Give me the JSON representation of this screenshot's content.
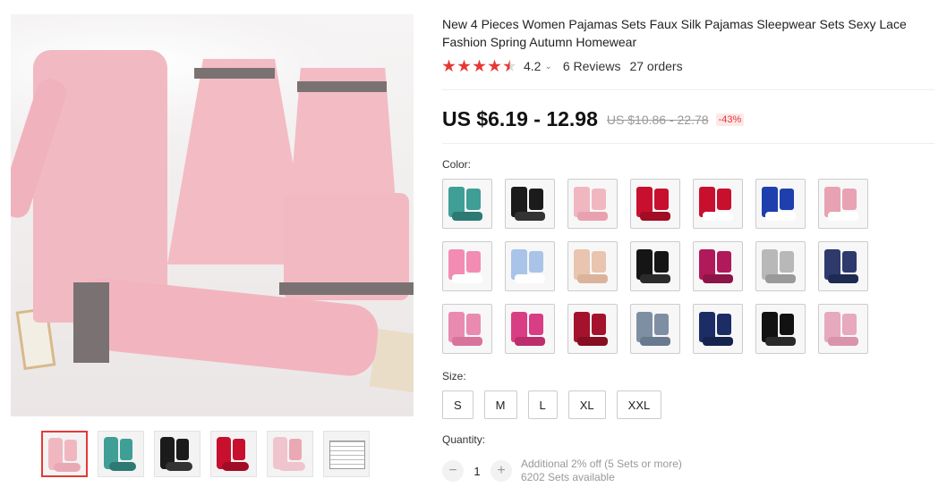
{
  "product": {
    "title": "New 4 Pieces Women Pajamas Sets Faux Silk Pajamas Sleepwear Sets Sexy Lace Fashion Spring Autumn Homewear",
    "rating_value": "4.2",
    "rating_stars": 4.5,
    "reviews": "6 Reviews",
    "orders": "27 orders",
    "price": "US $6.19 - 12.98",
    "old_price": "US $10.86 - 22.78",
    "discount": "-43%"
  },
  "labels": {
    "color": "Color:",
    "size": "Size:",
    "quantity": "Quantity:"
  },
  "thumbnails": [
    "pink set",
    "teal set",
    "black set",
    "red set",
    "pink gown",
    "size chart"
  ],
  "color_swatches": [
    {
      "main": "#3f9e96",
      "accent": "#2c7a73"
    },
    {
      "main": "#1b1b1b",
      "accent": "#333333"
    },
    {
      "main": "#f1b7c1",
      "accent": "#e9a1af"
    },
    {
      "main": "#c8102e",
      "accent": "#a00d24"
    },
    {
      "main": "#c8102e",
      "accent": "#ffffff"
    },
    {
      "main": "#1e3fae",
      "accent": "#ffffff"
    },
    {
      "main": "#e8a2b3",
      "accent": "#ffffff"
    },
    {
      "main": "#f28cb2",
      "accent": "#ffffff"
    },
    {
      "main": "#a9c4e8",
      "accent": "#ffffff"
    },
    {
      "main": "#e9c4ae",
      "accent": "#dbb39a"
    },
    {
      "main": "#151515",
      "accent": "#2b2b2b"
    },
    {
      "main": "#b0195a",
      "accent": "#8d1447"
    },
    {
      "main": "#b8b8b8",
      "accent": "#9a9a9a"
    },
    {
      "main": "#2d3a6b",
      "accent": "#1f2a52"
    },
    {
      "main": "#e98bb0",
      "accent": "#d8749b"
    },
    {
      "main": "#d93e84",
      "accent": "#bb2d6c"
    },
    {
      "main": "#a4122b",
      "accent": "#850e22"
    },
    {
      "main": "#7f8fa3",
      "accent": "#6a7a8e"
    },
    {
      "main": "#1c2d66",
      "accent": "#15234f"
    },
    {
      "main": "#121212",
      "accent": "#2a2a2a"
    },
    {
      "main": "#e6a9bd",
      "accent": "#d993ab"
    }
  ],
  "sizes": [
    "S",
    "M",
    "L",
    "XL",
    "XXL"
  ],
  "quantity": {
    "value": "1",
    "minus": "−",
    "plus": "+",
    "info_line1": "Additional 2% off (5 Sets or more)",
    "info_line2": "6202 Sets available"
  },
  "colors": {
    "accent": "#e53935"
  }
}
